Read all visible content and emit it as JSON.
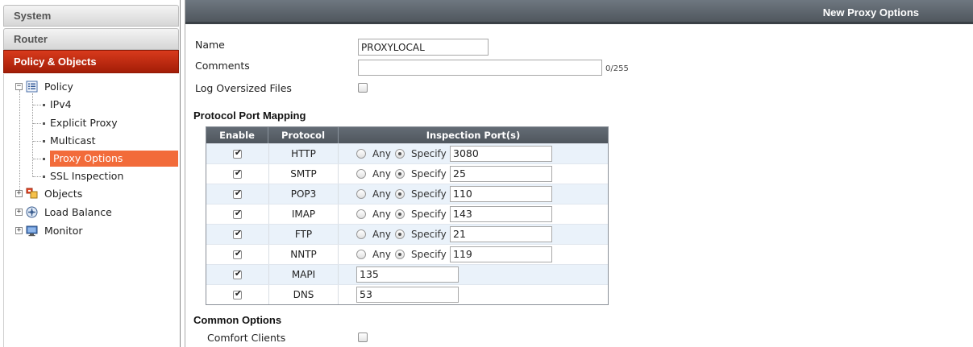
{
  "sidebar": {
    "headers": [
      "System",
      "Router",
      "Policy & Objects"
    ],
    "tree": {
      "policy": "Policy",
      "children": [
        "IPv4",
        "Explicit Proxy",
        "Multicast",
        "Proxy Options",
        "SSL Inspection"
      ],
      "objects": "Objects",
      "load_balance": "Load Balance",
      "monitor": "Monitor"
    },
    "selected": "Proxy Options"
  },
  "main": {
    "title": "New Proxy Options",
    "form": {
      "name_label": "Name",
      "name_value": "PROXYLOCAL",
      "comments_label": "Comments",
      "comments_value": "",
      "comments_counter": "0/255",
      "log_oversized_label": "Log Oversized Files"
    },
    "protocol_section_title": "Protocol Port Mapping",
    "table": {
      "columns": [
        "Enable",
        "Protocol",
        "Inspection Port(s)"
      ],
      "any_label": "Any",
      "specify_label": "Specify",
      "rows": [
        {
          "protocol": "HTTP",
          "enabled": true,
          "port": "3080",
          "mode": "specify"
        },
        {
          "protocol": "SMTP",
          "enabled": true,
          "port": "25",
          "mode": "specify"
        },
        {
          "protocol": "POP3",
          "enabled": true,
          "port": "110",
          "mode": "specify"
        },
        {
          "protocol": "IMAP",
          "enabled": true,
          "port": "143",
          "mode": "specify"
        },
        {
          "protocol": "FTP",
          "enabled": true,
          "port": "21",
          "mode": "specify"
        },
        {
          "protocol": "NNTP",
          "enabled": true,
          "port": "119",
          "mode": "specify"
        },
        {
          "protocol": "MAPI",
          "enabled": true,
          "port": "135",
          "mode": "fixed"
        },
        {
          "protocol": "DNS",
          "enabled": true,
          "port": "53",
          "mode": "fixed"
        }
      ]
    },
    "common_section_title": "Common Options",
    "comfort_clients_label": "Comfort Clients"
  }
}
